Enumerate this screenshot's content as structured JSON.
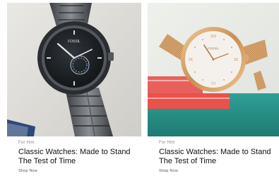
{
  "cards": [
    {
      "eyebrow": "For Him",
      "title": "Classic Watches: Made to Stand The Test of Time",
      "cta": "Shop Now",
      "image_alt": "Smoke stainless steel men's chronograph watch with black dial on linen fabric",
      "image_brand_mark": "FOSSIL",
      "dial_color": "#1e2226",
      "case_color": "#6b6e72"
    },
    {
      "eyebrow": "For Him",
      "title": "Classic Watches: Made to Stand The Test of Time",
      "cta": "Shop Now",
      "image_alt": "Rose gold mesh women's watch with white dial on coral and teal books",
      "image_brand_mark": "FOSSIL",
      "dial_color": "#f4f1ec",
      "case_color": "#d9a874"
    }
  ]
}
